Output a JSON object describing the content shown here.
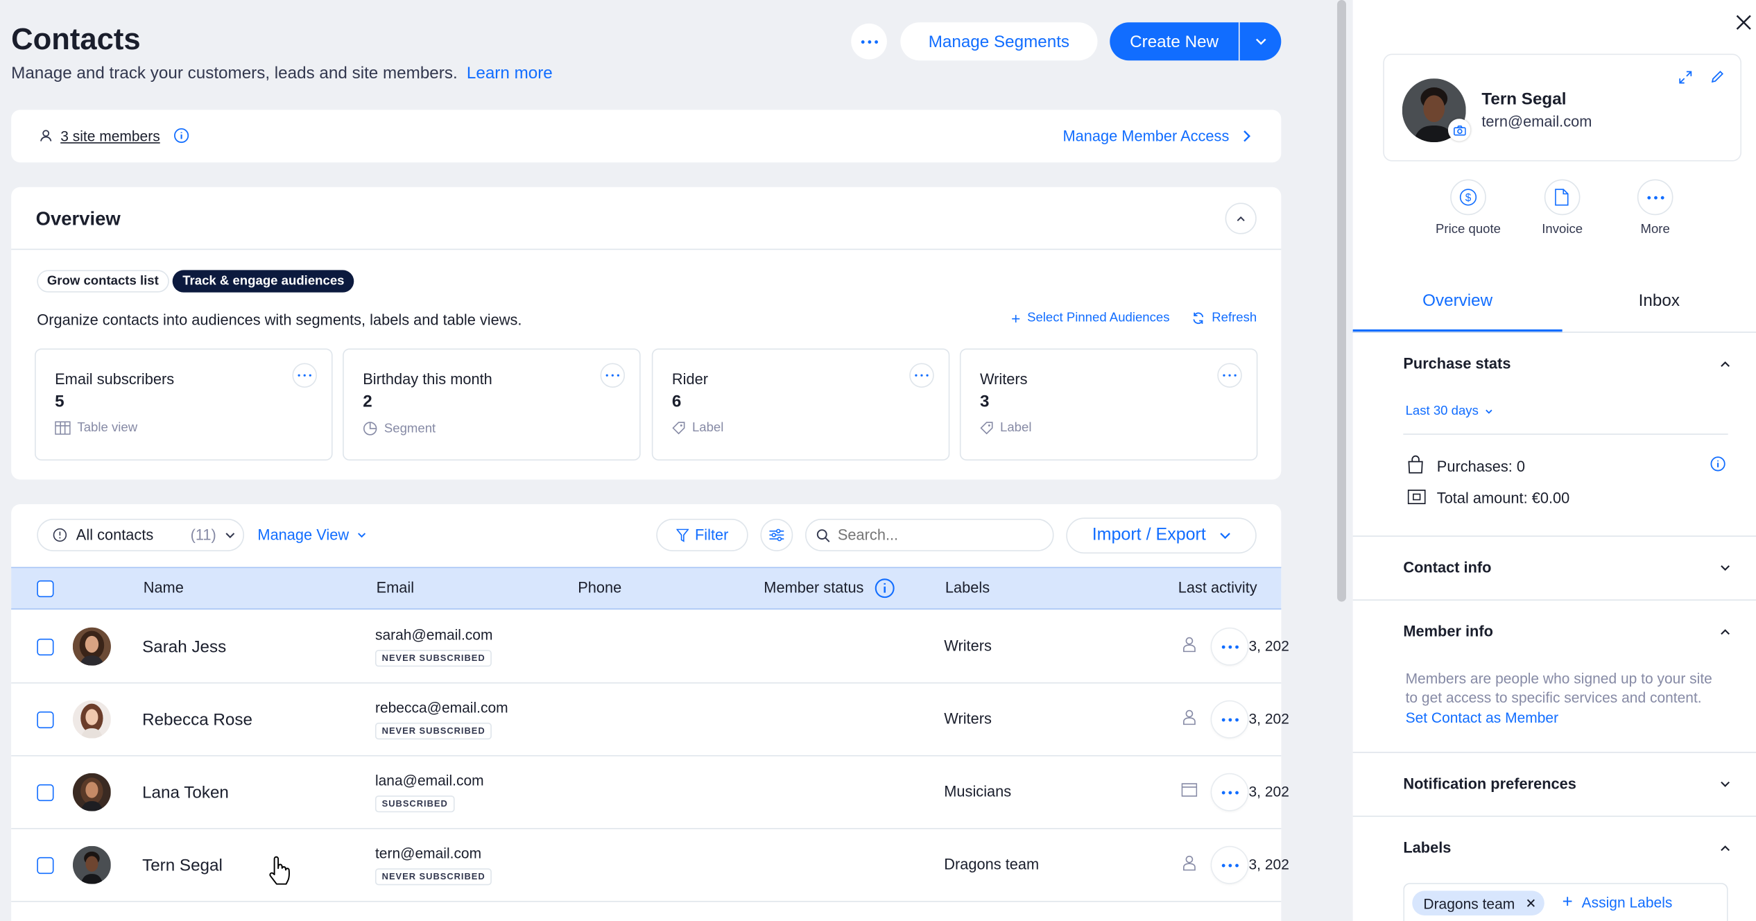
{
  "header": {
    "title": "Contacts",
    "subtitle": "Manage and track your customers, leads and site members.",
    "learn_more": "Learn more",
    "manage_segments": "Manage Segments",
    "create_new": "Create New"
  },
  "members_bar": {
    "site_members": "3 site members",
    "manage_access": "Manage Member Access"
  },
  "overview": {
    "title": "Overview",
    "tabs": [
      "Grow contacts list",
      "Track & engage audiences"
    ],
    "active_tab": "Track & engage audiences",
    "description": "Organize contacts into audiences with segments, labels and table views.",
    "select_pinned": "Select Pinned Audiences",
    "refresh": "Refresh",
    "cards": [
      {
        "title": "Email subscribers",
        "count": "5",
        "kind": "Table view",
        "icon": "table-icon"
      },
      {
        "title": "Birthday this month",
        "count": "2",
        "kind": "Segment",
        "icon": "segment-icon"
      },
      {
        "title": "Rider",
        "count": "6",
        "kind": "Label",
        "icon": "label-icon"
      },
      {
        "title": "Writers",
        "count": "3",
        "kind": "Label",
        "icon": "label-icon"
      }
    ]
  },
  "toolbar": {
    "all_contacts": "All contacts",
    "count": "(11)",
    "manage_view": "Manage View",
    "filter": "Filter",
    "search_placeholder": "Search...",
    "import_export": "Import / Export"
  },
  "table": {
    "columns": [
      "Name",
      "Email",
      "Phone",
      "Member status",
      "Labels",
      "Last activity"
    ],
    "rows": [
      {
        "name": "Sarah Jess",
        "email": "sarah@email.com",
        "status": "NEVER SUBSCRIBED",
        "label": "Writers",
        "date": "3, 202",
        "activity_icon": "person-icon"
      },
      {
        "name": "Rebecca Rose",
        "email": "rebecca@email.com",
        "status": "NEVER SUBSCRIBED",
        "label": "Writers",
        "date": "3, 202",
        "activity_icon": "person-icon"
      },
      {
        "name": "Lana Token",
        "email": "lana@email.com",
        "status": "SUBSCRIBED",
        "label": "Musicians",
        "date": "3, 202",
        "activity_icon": "window-icon"
      },
      {
        "name": "Tern Segal",
        "email": "tern@email.com",
        "status": "NEVER SUBSCRIBED",
        "label": "Dragons team",
        "date": "3, 202",
        "activity_icon": "person-icon"
      }
    ]
  },
  "panel": {
    "name": "Tern Segal",
    "email": "tern@email.com",
    "actions": [
      "Price quote",
      "Invoice",
      "More"
    ],
    "tabs": [
      "Overview",
      "Inbox"
    ],
    "active_tab": "Overview",
    "purchase_stats": {
      "title": "Purchase stats",
      "range": "Last 30 days",
      "purchases": "Purchases: 0",
      "total": "Total amount: €0.00"
    },
    "contact_info": "Contact info",
    "member_info": {
      "title": "Member info",
      "text_1": "Members are people who signed up to your site",
      "text_2": "to get access to specific services and content.",
      "link": "Set Contact as Member"
    },
    "notification_prefs": "Notification preferences",
    "labels": {
      "title": "Labels",
      "chip": "Dragons team",
      "assign": "Assign Labels"
    }
  },
  "colors": {
    "accent": "#116dff",
    "header_row": "#d8e6fd",
    "dark_chip": "#0c1a3e"
  }
}
